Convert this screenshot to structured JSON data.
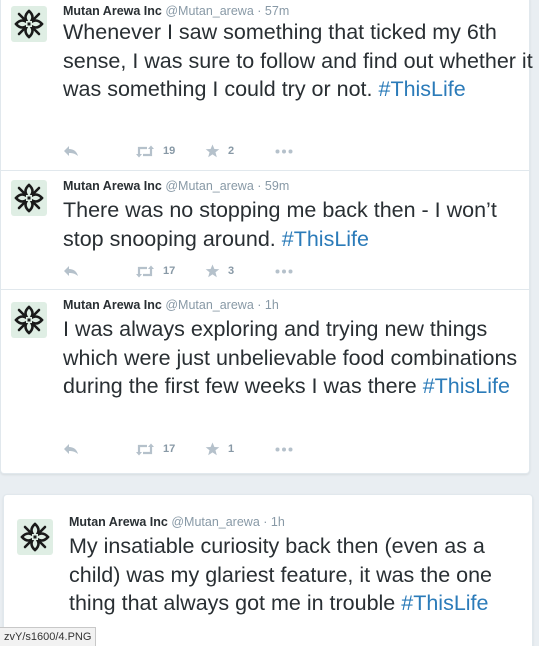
{
  "author": {
    "name": "Mutan Arewa Inc",
    "handle": "@Mutan_arewa",
    "separator": "·"
  },
  "tweets": [
    {
      "time": "57m",
      "text": "Whenever I saw something that ticked my 6th sense, I was sure to follow and find out whether it was something I could try or not. ",
      "hashtag": "#ThisLife",
      "retweets": "19",
      "favorites": "2"
    },
    {
      "time": "59m",
      "text": "There was no stopping me back then - I won’t stop snooping around. ",
      "hashtag": "#ThisLife",
      "retweets": "17",
      "favorites": "3"
    },
    {
      "time": "1h",
      "text": "I was always exploring and trying new things which were just unbelievable food combinations during the first few weeks I was there ",
      "hashtag": "#ThisLife",
      "retweets": "17",
      "favorites": "1"
    },
    {
      "time": "1h",
      "text": "My insatiable curiosity back then (even as a child) was my glariest feature, it was the one thing that always got me in trouble ",
      "hashtag": "#ThisLife"
    }
  ],
  "icons": {
    "avatar": "knot-logo-icon",
    "reply": "reply-icon",
    "retweet": "retweet-icon",
    "favorite": "star-icon",
    "more": "more-icon"
  },
  "colors": {
    "hashtag": "#2b7bb9",
    "muted": "#8899a6",
    "text": "#292f33",
    "avatar_bg": "#dfeee4"
  },
  "statusbar": {
    "text": "zvY/s1600/4.PNG"
  }
}
